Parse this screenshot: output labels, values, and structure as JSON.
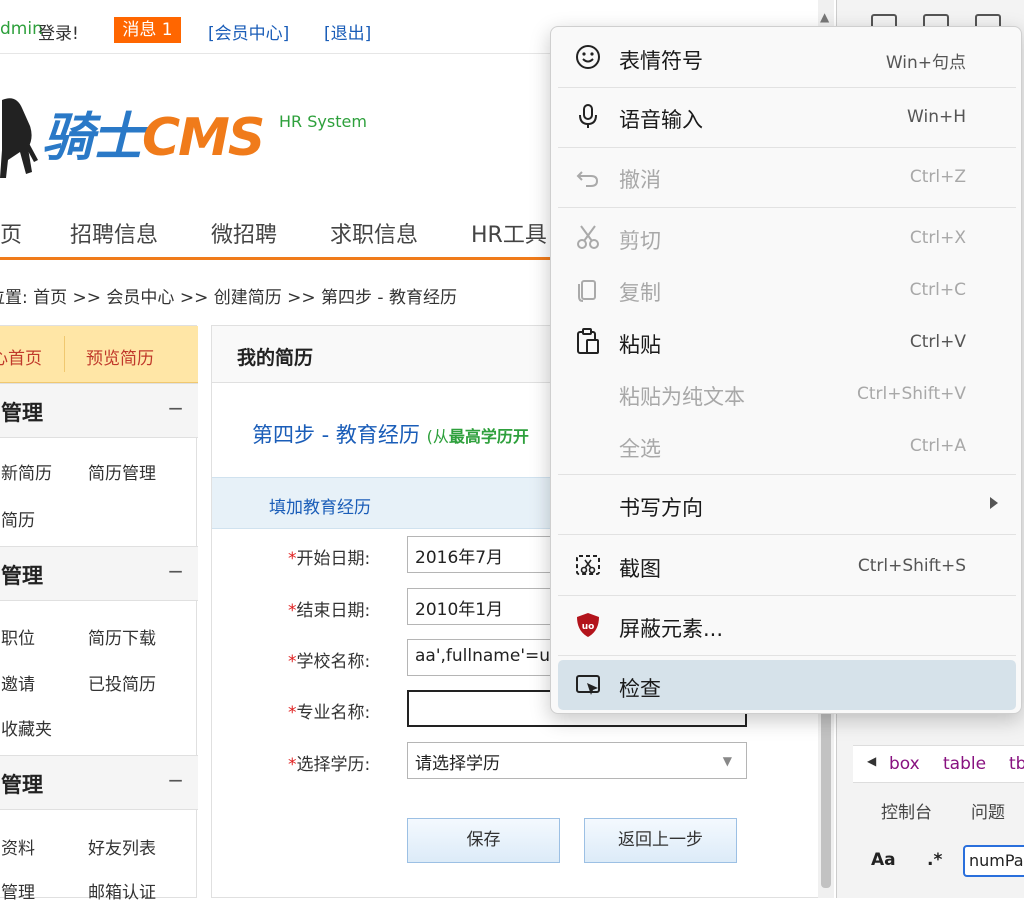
{
  "topbar": {
    "user_prefix": "dmin",
    "login_text": "登录!",
    "message_badge": "消息 1",
    "member_center": "[会员中心]",
    "logout": "[退出]"
  },
  "logo": {
    "brand_cn": "骑士",
    "brand_en": "CMS",
    "subtitle": "HR System"
  },
  "nav": {
    "items": [
      "页",
      "招聘信息",
      "微招聘",
      "求职信息",
      "HR工具"
    ]
  },
  "breadcrumb": "位置: 首页 >> 会员中心 >> 创建简历 >> 第四步 - 教育经历",
  "sidebar": {
    "top_links": [
      "心首页",
      "预览简历"
    ],
    "sections": [
      {
        "title": "管理",
        "toggle": "−",
        "links": [
          "新简历",
          "简历管理",
          "简历"
        ]
      },
      {
        "title": "管理",
        "toggle": "−",
        "links": [
          "职位",
          "简历下载",
          "邀请",
          "已投简历",
          "收藏夹"
        ]
      },
      {
        "title": "管理",
        "toggle": "−",
        "links": [
          "资料",
          "好友列表",
          "管理",
          "邮箱认证"
        ]
      }
    ]
  },
  "main": {
    "header": "我的简历",
    "step_title": "第四步 - 教育经历",
    "step_hint_prefix": "(从",
    "step_hint_bold": "最高学历开",
    "fill_header": "填加教育经历",
    "form": {
      "start_label": "开始日期:",
      "start_value": "2016年7月",
      "end_label": "结束日期:",
      "end_value": "2010年1月",
      "school_label": "学校名称:",
      "school_value": "aa',fullname'=us",
      "major_label": "专业名称:",
      "major_value": "",
      "edu_label": "选择学历:",
      "edu_value": "请选择学历",
      "required_mark": "*"
    },
    "save_button": "保存",
    "back_button": "返回上一步"
  },
  "devtools": {
    "crumbs": [
      "box",
      "table",
      "tb"
    ],
    "tabs": [
      "控制台",
      "问题"
    ],
    "search_aa": "Aa",
    "search_regex": ".*",
    "search_value": "numPa"
  },
  "context_menu": {
    "items": [
      {
        "label": "表情符号",
        "shortcut": "Win+句点",
        "icon": "smiley-icon",
        "disabled": false
      },
      {
        "label": "语音输入",
        "shortcut": "Win+H",
        "icon": "microphone-icon",
        "disabled": false
      },
      {
        "label": "撤消",
        "shortcut": "Ctrl+Z",
        "icon": "undo-icon",
        "disabled": true
      },
      {
        "label": "剪切",
        "shortcut": "Ctrl+X",
        "icon": "scissors-icon",
        "disabled": true
      },
      {
        "label": "复制",
        "shortcut": "Ctrl+C",
        "icon": "copy-icon",
        "disabled": true
      },
      {
        "label": "粘贴",
        "shortcut": "Ctrl+V",
        "icon": "paste-icon",
        "disabled": false
      },
      {
        "label": "粘贴为纯文本",
        "shortcut": "Ctrl+Shift+V",
        "icon": "",
        "disabled": true
      },
      {
        "label": "全选",
        "shortcut": "Ctrl+A",
        "icon": "",
        "disabled": true
      },
      {
        "label": "书写方向",
        "shortcut": "",
        "icon": "",
        "disabled": false
      },
      {
        "label": "截图",
        "shortcut": "Ctrl+Shift+S",
        "icon": "screenshot-icon",
        "disabled": false
      },
      {
        "label": "屏蔽元素...",
        "shortcut": "",
        "icon": "ublock-icon",
        "disabled": false
      },
      {
        "label": "检查",
        "shortcut": "",
        "icon": "inspect-icon",
        "disabled": false
      }
    ]
  },
  "colors": {
    "accent_orange": "#ff6600",
    "link_blue": "#1a5db8",
    "highlight": "#d6e2ea"
  }
}
